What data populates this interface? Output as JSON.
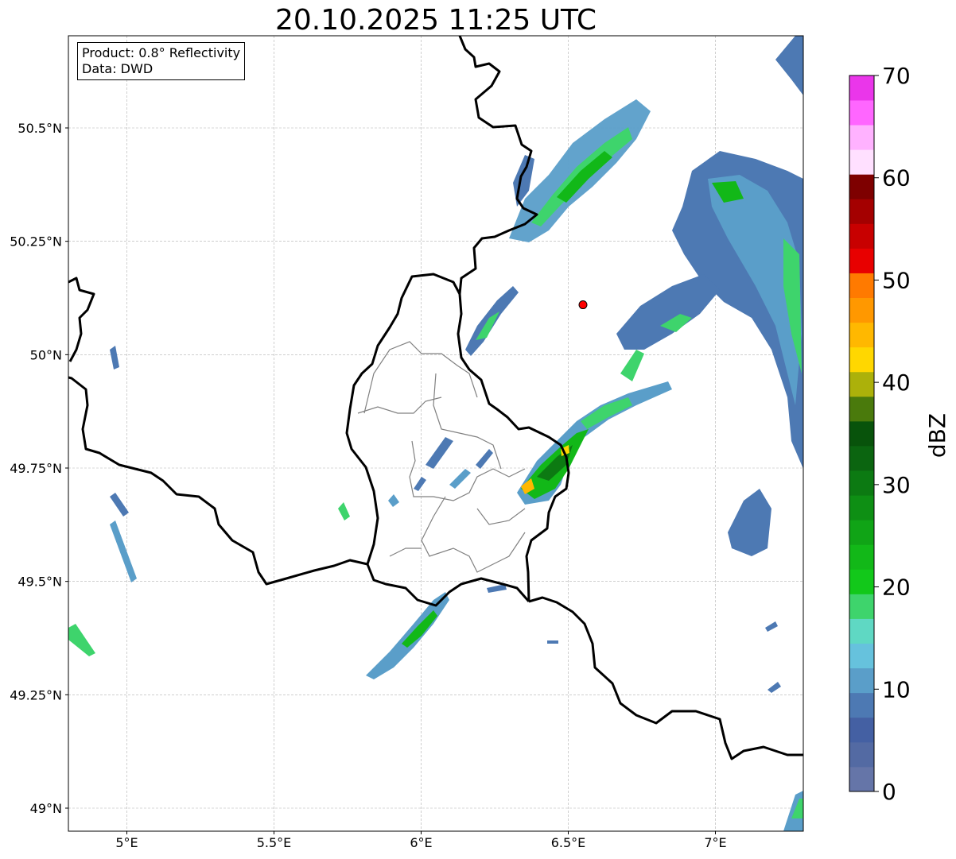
{
  "title": "20.10.2025 11:25 UTC",
  "info_box": {
    "product": "Product: 0.8° Reflectivity",
    "source": "Data: DWD"
  },
  "map": {
    "lon_range": [
      4.8,
      7.3
    ],
    "lat_range": [
      48.95,
      50.7
    ],
    "grid": "dashed",
    "x_ticks": [
      {
        "value": 5.0,
        "label": "5°E"
      },
      {
        "value": 5.5,
        "label": "5.5°E"
      },
      {
        "value": 6.0,
        "label": "6°E"
      },
      {
        "value": 6.5,
        "label": "6.5°E"
      },
      {
        "value": 7.0,
        "label": "7°E"
      }
    ],
    "y_ticks": [
      {
        "value": 50.5,
        "label": "50.5°N"
      },
      {
        "value": 50.25,
        "label": "50.25°N"
      },
      {
        "value": 50.0,
        "label": "50°N"
      },
      {
        "value": 49.75,
        "label": "49.75°N"
      },
      {
        "value": 49.5,
        "label": "49.5°N"
      },
      {
        "value": 49.25,
        "label": "49.25°N"
      },
      {
        "value": 49.0,
        "label": "49°N"
      }
    ],
    "radar_site": {
      "lon": 6.55,
      "lat": 50.11,
      "color": "#ff0000"
    },
    "borders_color": "#000000",
    "districts_color": "#808080"
  },
  "colorbar": {
    "label": "dBZ",
    "range": [
      0,
      70
    ],
    "ticks": [
      {
        "value": 0,
        "label": "0"
      },
      {
        "value": 10,
        "label": "10"
      },
      {
        "value": 20,
        "label": "20"
      },
      {
        "value": 30,
        "label": "30"
      },
      {
        "value": 40,
        "label": "40"
      },
      {
        "value": 50,
        "label": "50"
      },
      {
        "value": 60,
        "label": "60"
      },
      {
        "value": 70,
        "label": "70"
      }
    ],
    "colors": [
      "#6575a8",
      "#536aa3",
      "#4460a3",
      "#4d79b3",
      "#5a9ec9",
      "#66c2dd",
      "#5fd8c3",
      "#3ed46c",
      "#12c81a",
      "#12b818",
      "#10a416",
      "#0e8f14",
      "#0c7a12",
      "#0b6510",
      "#08530b",
      "#4a7a0c",
      "#acb10a",
      "#ffd700",
      "#ffb800",
      "#ff9800",
      "#ff7a00",
      "#e80000",
      "#c80000",
      "#a40000",
      "#7e0000",
      "#ffe0ff",
      "#ffb2ff",
      "#ff66ff",
      "#ea36ea"
    ]
  }
}
